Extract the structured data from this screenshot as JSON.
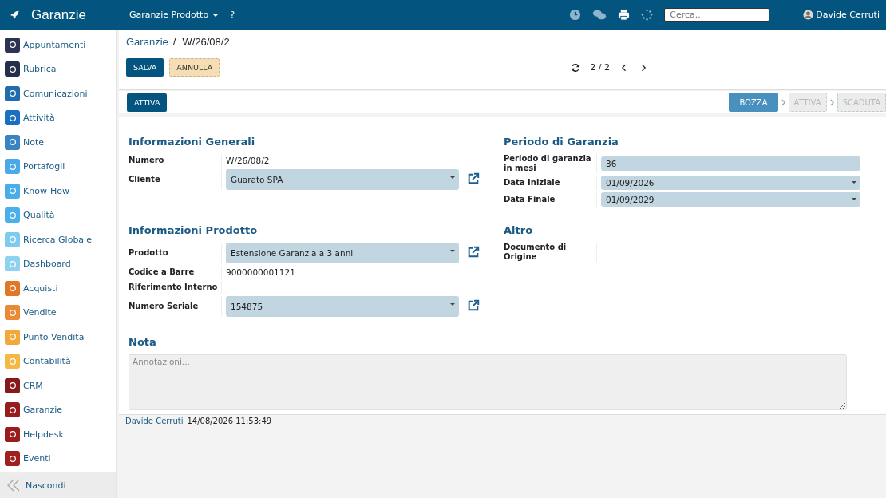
{
  "app": {
    "title": "Garanzie"
  },
  "topbar": {
    "menu": "Garanzie Prodotto",
    "help": "?",
    "search": {
      "placeholder": "Cerca..."
    },
    "user": "Davide Cerruti"
  },
  "sidebar": {
    "items": [
      {
        "label": "Appuntamenti",
        "color": "#2b3452",
        "selected": false
      },
      {
        "label": "Rubrica",
        "color": "#243049",
        "selected": false
      },
      {
        "label": "Comunicazioni",
        "color": "#1f6dad",
        "selected": false
      },
      {
        "label": "Attività",
        "color": "#1b6fc0",
        "selected": false
      },
      {
        "label": "Note",
        "color": "#3a84c4",
        "selected": false
      },
      {
        "label": "Portafogli",
        "color": "#4aa9e9",
        "selected": false
      },
      {
        "label": "Know-How",
        "color": "#48aee9",
        "selected": false
      },
      {
        "label": "Qualità",
        "color": "#4bb0ea",
        "selected": false
      },
      {
        "label": "Ricerca Globale",
        "color": "#7ecbef",
        "selected": false
      },
      {
        "label": "Dashboard",
        "color": "#8dd2f1",
        "selected": false
      },
      {
        "label": "Acquisti",
        "color": "#e07828",
        "selected": false
      },
      {
        "label": "Vendite",
        "color": "#e98a36",
        "selected": false
      },
      {
        "label": "Punto Vendita",
        "color": "#f2a83b",
        "selected": false
      },
      {
        "label": "Contabilità",
        "color": "#f4b942",
        "selected": false
      },
      {
        "label": "CRM",
        "color": "#861a1a",
        "selected": false
      },
      {
        "label": "Garanzie",
        "color": "#971c1c",
        "selected": false
      },
      {
        "label": "Helpdesk",
        "color": "#9a1c1c",
        "selected": false
      },
      {
        "label": "Eventi",
        "color": "#a02020",
        "selected": false
      }
    ],
    "collapse": "Nascondi"
  },
  "breadcrumb": {
    "parent": "Garanzie",
    "separator": "/",
    "current": "W/26/08/2"
  },
  "buttons": [
    {
      "label": "SALVA",
      "kind": "primary"
    },
    {
      "label": "ANNULLA",
      "kind": "secondary"
    }
  ],
  "pager": {
    "counter": "2 / 2"
  },
  "action_button": "ATTIVA",
  "status_steps": [
    {
      "label": "BOZZA",
      "selected": true
    },
    {
      "label": "ATTIVA",
      "selected": false
    },
    {
      "label": "SCADUTA",
      "selected": false
    }
  ],
  "sections": [
    {
      "title": "Informazioni Generali",
      "fields": [
        {
          "label": "Numero",
          "kind": "text",
          "value": "W/26/08/2"
        },
        {
          "label": "Cliente",
          "kind": "select",
          "value": "Guarato SPA",
          "link": true
        }
      ]
    },
    {
      "title": "Periodo di Garanzia",
      "fields": [
        {
          "label": "Periodo di garanzia in mesi",
          "kind": "input",
          "value": "36"
        },
        {
          "label": "Data Iniziale",
          "kind": "date",
          "value": "01/09/2026"
        },
        {
          "label": "Data Finale",
          "kind": "date",
          "value": "01/09/2029"
        }
      ]
    },
    {
      "title": "Informazioni Prodotto",
      "fields": [
        {
          "label": "Prodotto",
          "kind": "select",
          "value": "Estensione Garanzia a 3 anni",
          "link": true
        },
        {
          "label": "Codice a Barre",
          "kind": "text",
          "value": "9000000001121"
        },
        {
          "label": "Riferimento Interno",
          "kind": "text"
        },
        {
          "label": "Numero Seriale",
          "kind": "select",
          "value": "154875",
          "link": true
        }
      ]
    },
    {
      "title": "Altro",
      "fields": [
        {
          "label": "Documento di Origine",
          "kind": "text"
        }
      ]
    }
  ],
  "note": {
    "title": "Nota",
    "placeholder": "Annotazioni..."
  },
  "footer": {
    "author": "Davide Cerruti",
    "timestamp": "14/08/2026 11:53:49"
  }
}
